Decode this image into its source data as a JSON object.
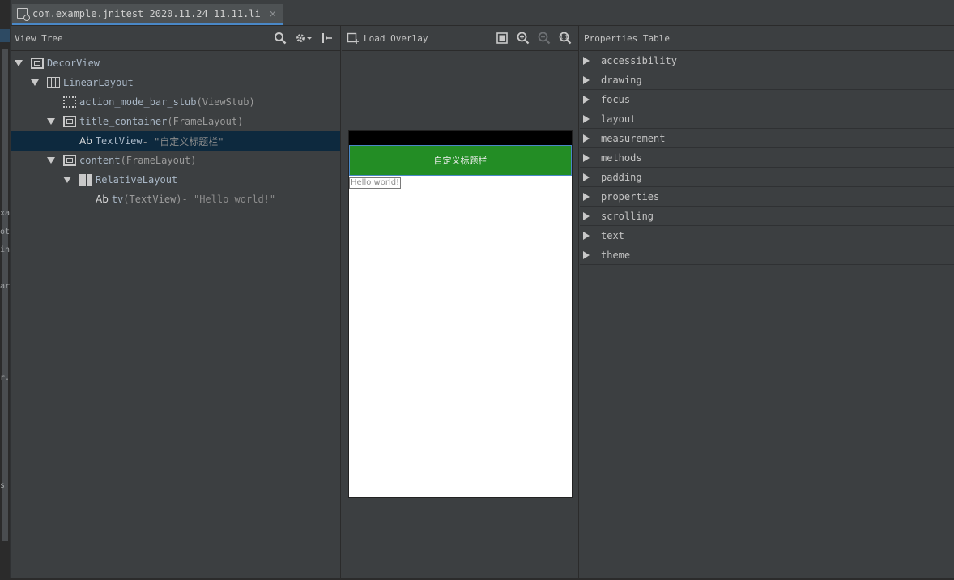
{
  "tab": {
    "title": "com.example.jnitest_2020.11.24_11.11.li",
    "close": "×"
  },
  "gutter": {
    "fragments": [
      "xa",
      "ot",
      "in",
      "ar",
      "r.",
      "s"
    ]
  },
  "view_tree": {
    "title": "View Tree",
    "nodes": [
      {
        "label": "DecorView",
        "sub": "",
        "quote": ""
      },
      {
        "label": "LinearLayout",
        "sub": "",
        "quote": ""
      },
      {
        "label": "action_mode_bar_stub",
        "sub": " (ViewStub)",
        "quote": ""
      },
      {
        "label": "title_container",
        "sub": " (FrameLayout)",
        "quote": ""
      },
      {
        "label": "TextView",
        "sub": "",
        "quote": " - \"自定义标题栏\""
      },
      {
        "label": "content",
        "sub": " (FrameLayout)",
        "quote": ""
      },
      {
        "label": "RelativeLayout",
        "sub": "",
        "quote": ""
      },
      {
        "label": "tv",
        "sub": " (TextView)",
        "quote": " - \"Hello world!\""
      }
    ],
    "ab": "Ab"
  },
  "preview": {
    "load_overlay": "Load Overlay",
    "title_bar_text": "自定义标题栏",
    "hello_text": "Hello world!"
  },
  "properties": {
    "title": "Properties Table",
    "items": [
      "accessibility",
      "drawing",
      "focus",
      "layout",
      "measurement",
      "methods",
      "padding",
      "properties",
      "scrolling",
      "text",
      "theme"
    ]
  },
  "colors": {
    "background": "#3c3f41",
    "selection": "#0d293e",
    "title_bar_green": "#238d25",
    "tab_accent": "#4a88c7"
  },
  "icons": {
    "toolbar_tree": [
      "search-icon",
      "gear-dropdown-icon",
      "collapse-icon"
    ],
    "toolbar_preview": [
      "fit-screen-icon",
      "zoom-in-icon",
      "zoom-out-icon",
      "actual-size-icon"
    ]
  }
}
